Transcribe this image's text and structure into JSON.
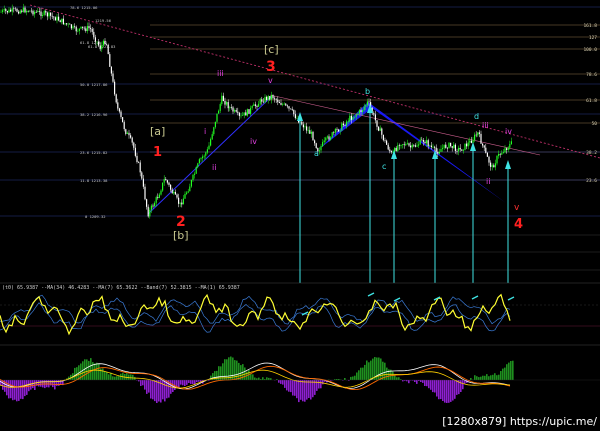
{
  "colors": {
    "background": "#000000",
    "price_up": "#22ff22",
    "price_down": "#ffffff",
    "pattern_fill": "#1a1aff",
    "fib_line": "#b08a5a",
    "trend_line": "#c0306a",
    "arrow": "#3fe3e3",
    "oscillator_main": "#ffff33",
    "oscillator_band": "#3a7ad5",
    "hist_up": "#1f8f1f",
    "hist_down": "#8e1fd0",
    "macd_line_a": "#ffffff",
    "macd_line_b": "#ff6a00",
    "macd_line_c": "#ffd000"
  },
  "fib_right": [
    "161.8",
    "127",
    "100.0",
    "78.6",
    "61.8",
    "50",
    "38.2",
    "23.6"
  ],
  "fib_left": [
    "78.6  1215.06",
    "61.8  1218.72",
    "50.0  1217.86",
    "38.2  1216.96",
    "23.6  1215.82",
    "11.8  1213.38",
    "0  1209.32",
    "61.8  1221.83",
    "1219.56"
  ],
  "wave_labels": {
    "w3": "3",
    "w2": "2",
    "w1": "1",
    "w4": "4",
    "wv": "v",
    "bracket_a": "[a]",
    "bracket_b": "[b]",
    "bracket_c": "[c]",
    "iii": "iii",
    "ii": "ii",
    "i": "i",
    "iv_left": "iv",
    "v_small": "v",
    "a": "a",
    "b": "b",
    "c": "c",
    "d": "d",
    "iv_right": "iv",
    "ii_right": "ii",
    "iii_right": "iii"
  },
  "oscillator_header": "(t0) 65.9387  --MA(34) 46.4283  --MA(7) 65.3622  --Band(7) 52.3815  --MA(1) 65.9387",
  "watermark": "[1280x879] https://upic.me/"
}
